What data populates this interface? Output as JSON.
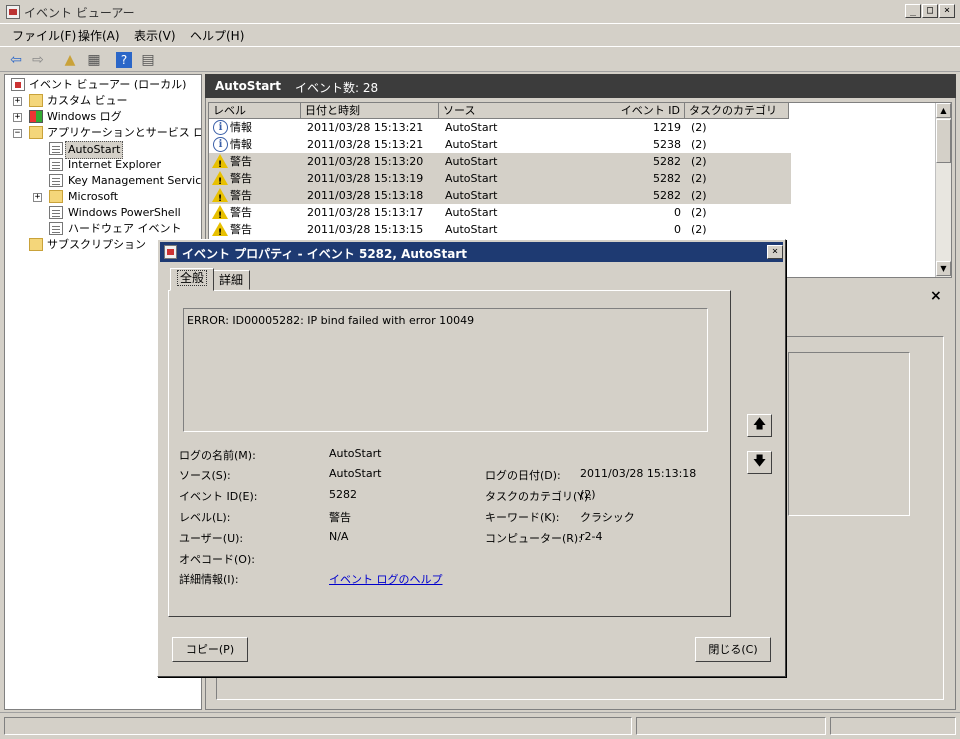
{
  "window": {
    "title": "イベント ビューアー"
  },
  "menu": [
    "ファイル(F)",
    "操作(A)",
    "表示(V)",
    "ヘルプ(H)"
  ],
  "tree": {
    "root": "イベント ビューアー (ローカル)",
    "custom_views": "カスタム ビュー",
    "windows_logs": "Windows ログ",
    "app_services": "アプリケーションとサービス ログ",
    "children": [
      "AutoStart",
      "Internet Explorer",
      "Key Management Service",
      "Microsoft",
      "Windows PowerShell",
      "ハードウェア イベント"
    ],
    "subscriptions": "サブスクリプション"
  },
  "log_header": {
    "name": "AutoStart",
    "count_label": "イベント数: 28"
  },
  "columns": [
    "レベル",
    "日付と時刻",
    "ソース",
    "イベント ID",
    "タスクのカテゴリ"
  ],
  "events": [
    {
      "level": "情報",
      "icon": "info-icon",
      "datetime": "2011/03/28 15:13:21",
      "source": "AutoStart",
      "id": "1219",
      "category": "(2)"
    },
    {
      "level": "情報",
      "icon": "info-icon",
      "datetime": "2011/03/28 15:13:21",
      "source": "AutoStart",
      "id": "5238",
      "category": "(2)"
    },
    {
      "level": "警告",
      "icon": "warning-icon",
      "datetime": "2011/03/28 15:13:20",
      "source": "AutoStart",
      "id": "5282",
      "category": "(2)"
    },
    {
      "level": "警告",
      "icon": "warning-icon",
      "datetime": "2011/03/28 15:13:19",
      "source": "AutoStart",
      "id": "5282",
      "category": "(2)"
    },
    {
      "level": "警告",
      "icon": "warning-icon",
      "datetime": "2011/03/28 15:13:18",
      "source": "AutoStart",
      "id": "5282",
      "category": "(2)"
    },
    {
      "level": "警告",
      "icon": "warning-icon",
      "datetime": "2011/03/28 15:13:17",
      "source": "AutoStart",
      "id": "0",
      "category": "(2)"
    },
    {
      "level": "警告",
      "icon": "warning-icon",
      "datetime": "2011/03/28 15:13:15",
      "source": "AutoStart",
      "id": "0",
      "category": "(2)"
    }
  ],
  "dialog": {
    "title": "イベント プロパティ - イベント 5282, AutoStart",
    "tabs": [
      "全般",
      "詳細"
    ],
    "message": "ERROR: ID00005282: IP bind failed with error 10049",
    "labels": {
      "log_name": "ログの名前(M):",
      "source": "ソース(S):",
      "event_id": "イベント ID(E):",
      "level": "レベル(L):",
      "user": "ユーザー(U):",
      "opcode": "オペコード(O):",
      "more_info": "詳細情報(I):",
      "logged": "ログの日付(D):",
      "task_category": "タスクのカテゴリ(Y):",
      "keywords": "キーワード(K):",
      "computer": "コンピューター(R):"
    },
    "values": {
      "log_name": "AutoStart",
      "source": "AutoStart",
      "event_id": "5282",
      "level": "警告",
      "user": "N/A",
      "opcode": "",
      "more_info": "イベント ログのヘルプ",
      "logged": "2011/03/28 15:13:18",
      "task_category": "(2)",
      "keywords": "クラシック",
      "computer": "r2-4"
    },
    "buttons": {
      "copy": "コピー(P)",
      "close": "閉じる(C)"
    }
  }
}
